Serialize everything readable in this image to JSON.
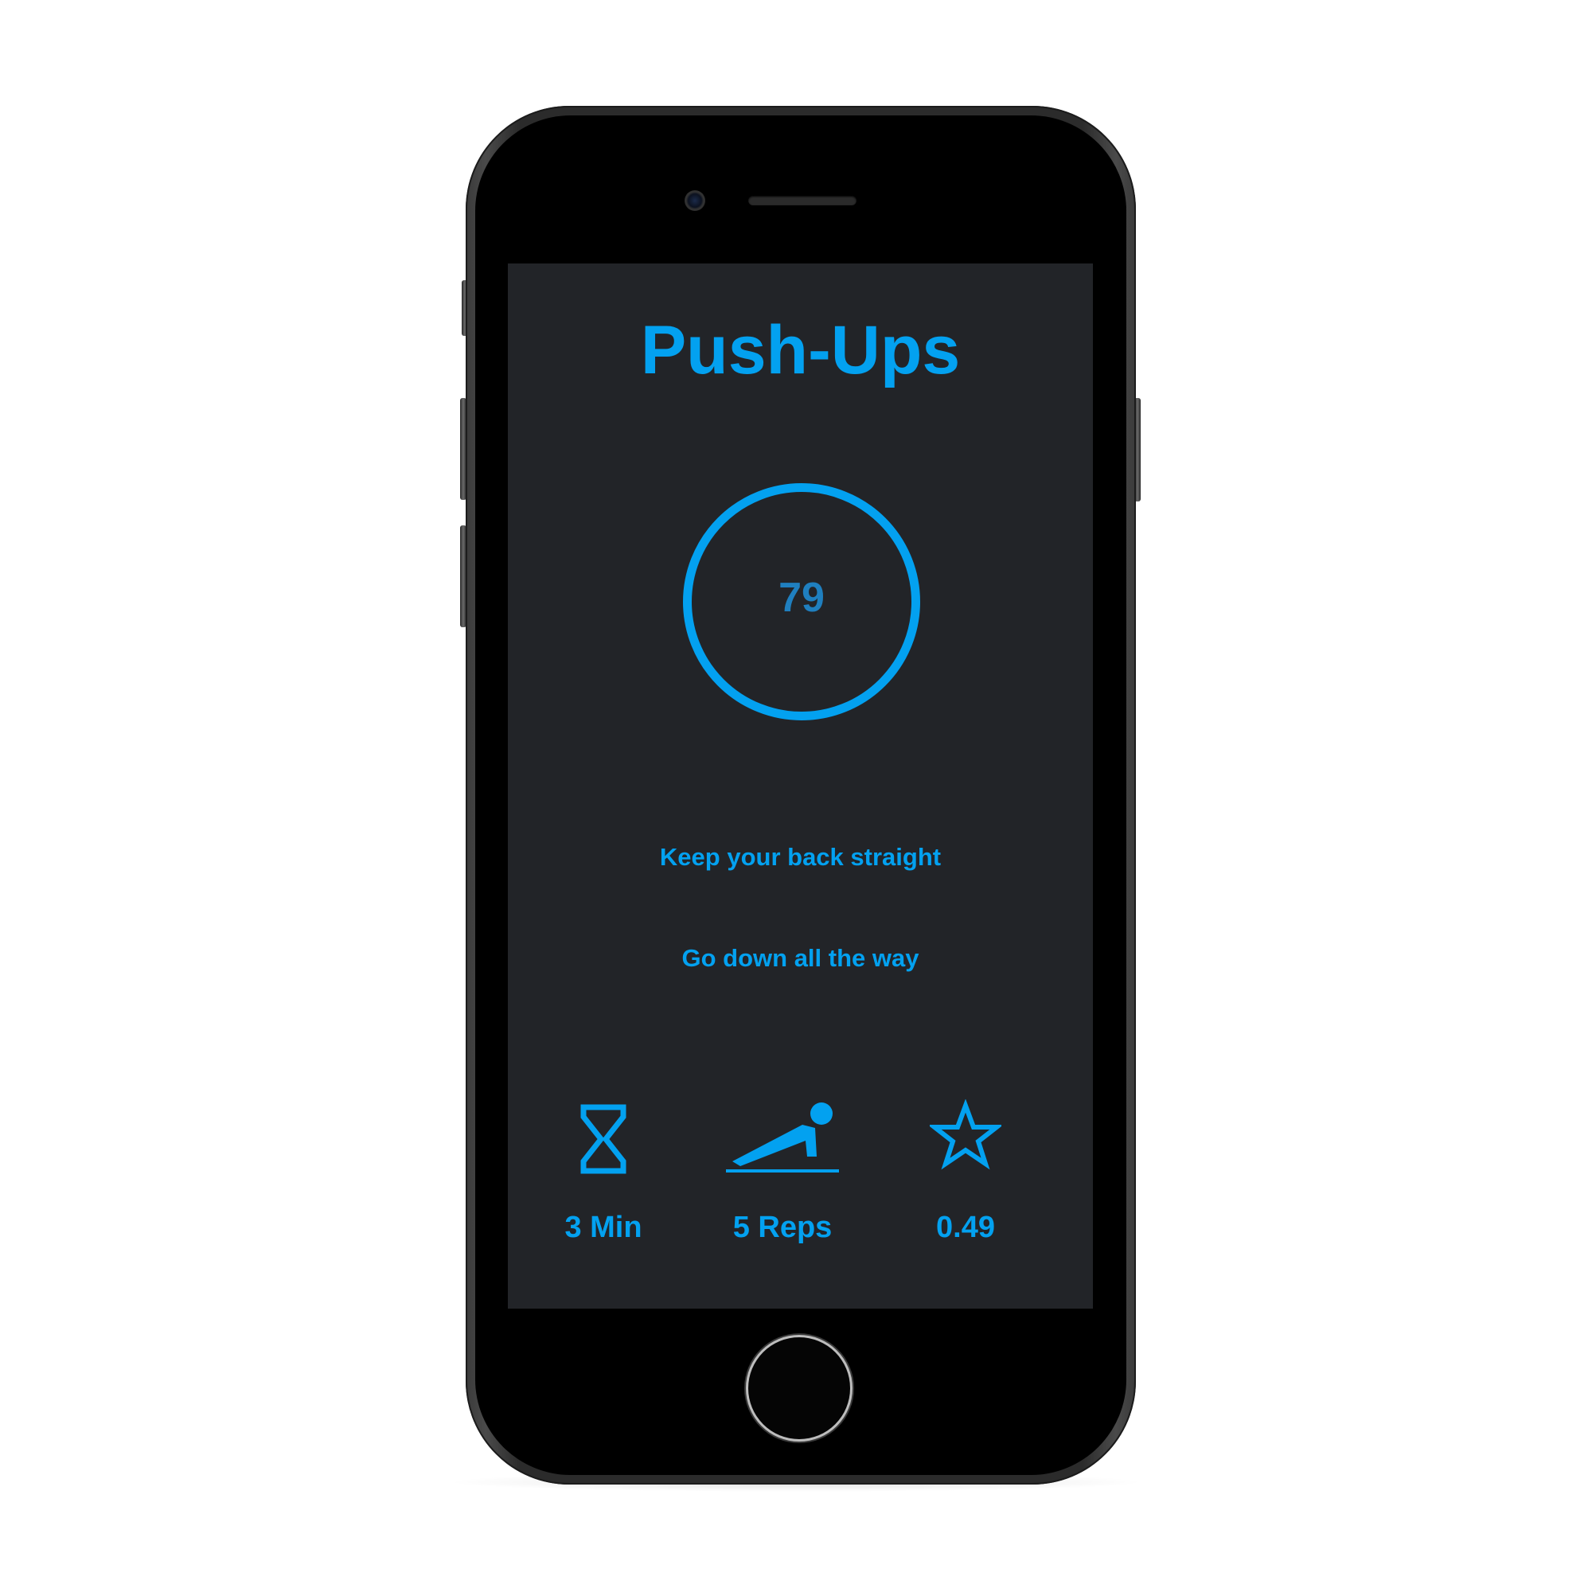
{
  "app": {
    "title": "Push-Ups",
    "accent_color": "#03a1f0",
    "background_color": "#222428"
  },
  "counter": {
    "value": "79"
  },
  "tips": [
    "Keep your back straight",
    "Go down all the way"
  ],
  "stats": [
    {
      "icon": "hourglass-icon",
      "label": "3 Min"
    },
    {
      "icon": "push-up-icon",
      "label": "5 Reps"
    },
    {
      "icon": "star-icon",
      "label": "0.49"
    }
  ]
}
